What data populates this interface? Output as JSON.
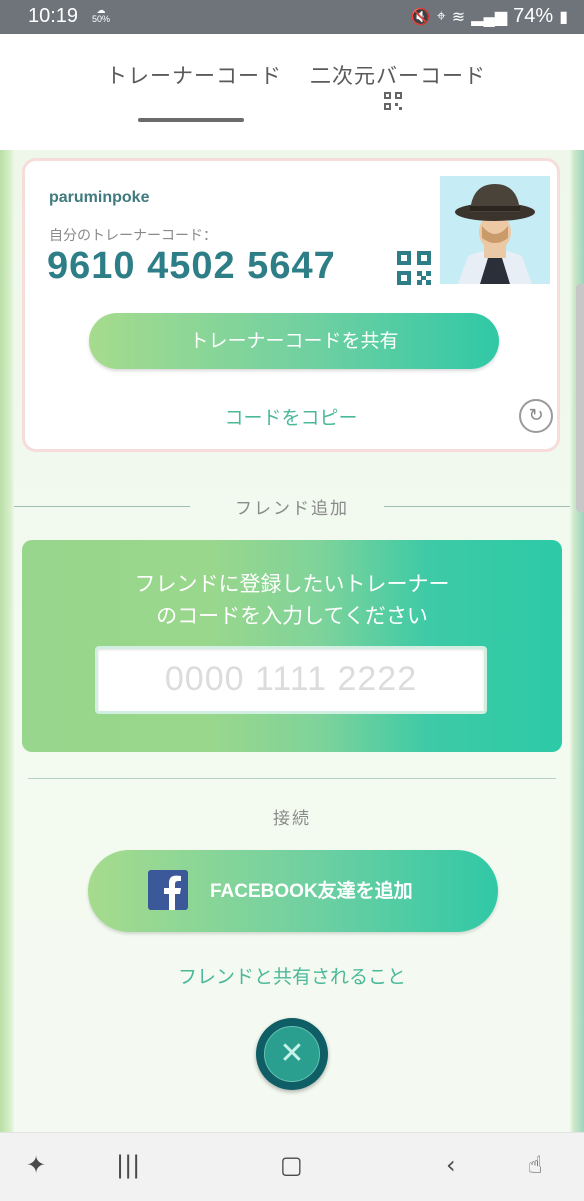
{
  "status_bar": {
    "time": "10:19",
    "cloud_percent": "50%",
    "battery": "74%"
  },
  "tabs": [
    {
      "label": "トレーナーコード",
      "selected": true
    },
    {
      "label": "二次元バーコード",
      "selected": false
    }
  ],
  "trainer_card": {
    "username": "paruminpoke",
    "code_label": "自分のトレーナーコード：",
    "code": "9610 4502 5647",
    "share_button": "トレーナーコードを共有",
    "copy_link": "コードをコピー"
  },
  "friend_add": {
    "section_title": "フレンド追加",
    "instruction_line1": "フレンドに登録したいトレーナー",
    "instruction_line2": "のコードを入力してください",
    "code_input_placeholder": "0000 1111 2222"
  },
  "connect": {
    "section_title": "接続",
    "facebook_button": "FACEBOOK友達を追加",
    "share_info_link": "フレンドと共有されること"
  },
  "colors": {
    "accent_teal": "#2d7e87",
    "link_green": "#4bb89a",
    "status_bar": "#6f747b"
  },
  "icons": {
    "qr": "qr-code-icon",
    "refresh": "refresh-icon",
    "close": "close-icon",
    "facebook": "facebook-icon"
  }
}
